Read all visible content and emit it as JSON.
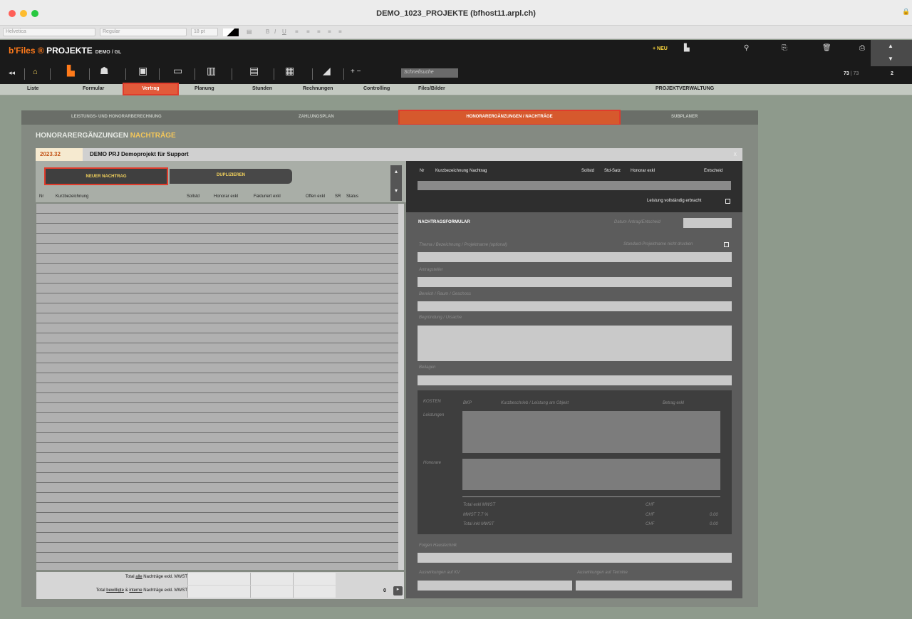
{
  "window": {
    "title": "DEMO_1023_PROJEKTE (bfhost11.arpl.ch)"
  },
  "format_toolbar": {
    "font": "Helvetica",
    "style": "Regular",
    "size": "18 pt"
  },
  "header": {
    "brand_prefix": "b'Files",
    "brand_symbol": "®",
    "brand_name": "PROJEKTE",
    "context": "DEMO / GL",
    "new_label": "+ NEU",
    "quicksearch_placeholder": "Schnellsuche",
    "record_current": "73",
    "record_total": "73",
    "secondary_count": "2"
  },
  "menu": {
    "items": [
      "Liste",
      "Formular",
      "Vertrag",
      "Planung",
      "Stunden",
      "Rechnungen",
      "Controlling",
      "Files/Bilder"
    ],
    "active": "Vertrag",
    "section_title": "PROJEKTVERWALTUNG"
  },
  "subtabs": {
    "items": [
      "LEISTUNGS- UND HONORARBERECHNUNG",
      "ZAHLUNGSPLAN",
      "HONORARERGÄNZUNGEN / NACHTRÄGE",
      "SUBPLANER"
    ],
    "active": "HONORARERGÄNZUNGEN / NACHTRÄGE"
  },
  "panel": {
    "title_main": "HONORARERGÄNZUNGEN",
    "title_accent": "NACHTRÄGE",
    "project_number": "2023.32",
    "project_name": "DEMO PRJ Demoprojekt für Support",
    "close": "x"
  },
  "list": {
    "new_button": "NEUER NACHTRAG",
    "duplicate_button": "DUPLIZIEREN",
    "columns": [
      "Nr",
      "Kurzbezeichnung",
      "Sollstd",
      "Honorar exkl",
      "Fakturiert exkl",
      "Offen exkl",
      "SR",
      "Status"
    ],
    "total_all_label_pre": "Total ",
    "total_all_label_link": "alle",
    "total_all_label_post": " Nachträge exkl. MWST",
    "total_approved_label_pre": "Total ",
    "total_approved_label_link1": "bewilligte",
    "total_approved_label_mid": " & ",
    "total_approved_label_link2": "interne",
    "total_approved_label_post": " Nachträge exkl. MWST",
    "count": "0"
  },
  "detail": {
    "columns": [
      "Nr",
      "Kurzbezeichnung Nachtrag",
      "Sollstd",
      "Std-Satz",
      "Honorar exkl",
      "Entscheid"
    ],
    "complete_label": "Leistung vollständig erbracht",
    "form_title": "NACHTRAGSFORMULAR",
    "date_label": "Datum Antrag/Entscheid",
    "topic_label": "Thema / Bezeichnung / Projektname (optional)",
    "no_print_label": "Standard-Projektname nicht drucken",
    "requester_label": "Antragsteller",
    "area_label": "Bereich / Raum / Geschoss",
    "reason_label": "Begründung / Ursache",
    "attachments_label": "Beilagen",
    "costs": {
      "title": "KOSTEN",
      "bkp": "BKP",
      "desc": "Kurzbeschrieb / Leistung am Objekt",
      "amount": "Betrag exkl",
      "services": "Leistungen",
      "fees": "Honorare",
      "total_excl": "Total exkl MWST",
      "vat": "MWST 7.7 %",
      "total_incl": "Total inkl MWST",
      "currency": "CHF",
      "vat_value": "0.00",
      "total_incl_value": "0.00"
    },
    "building_services_label": "Folgen Haustechnik",
    "impact_kv_label": "Auswirkungen auf KV",
    "impact_schedule_label": "Auswirkungen auf Termine"
  }
}
